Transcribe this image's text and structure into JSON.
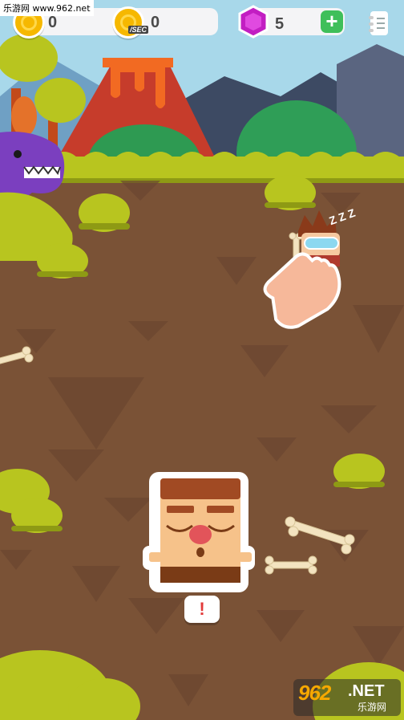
{
  "watermark": {
    "text": "乐游网 www.962.net"
  },
  "hud": {
    "coins": {
      "value": "0",
      "icon": "coin-icon"
    },
    "coins_per_sec": {
      "value": "0",
      "icon": "coin-per-sec-icon",
      "tag": "/SEC"
    },
    "gems": {
      "value": "5",
      "icon": "gem-icon",
      "add_label": "+"
    },
    "menu": {
      "icon": "notebook-icon"
    }
  },
  "scene": {
    "alert_text": "!",
    "sleep_text": "Z Z Z"
  },
  "logo": {
    "big": "962",
    "net": ".NET",
    "cn": "乐游网"
  },
  "colors": {
    "ground": "#7a5236",
    "grass": "#b8c51f",
    "sky": "#9fd4e8",
    "volcano": "#c63c2b",
    "lava": "#f26a22",
    "dino": "#7b3fbf",
    "gem": "#c21ec2",
    "plus": "#3fbf5a"
  }
}
